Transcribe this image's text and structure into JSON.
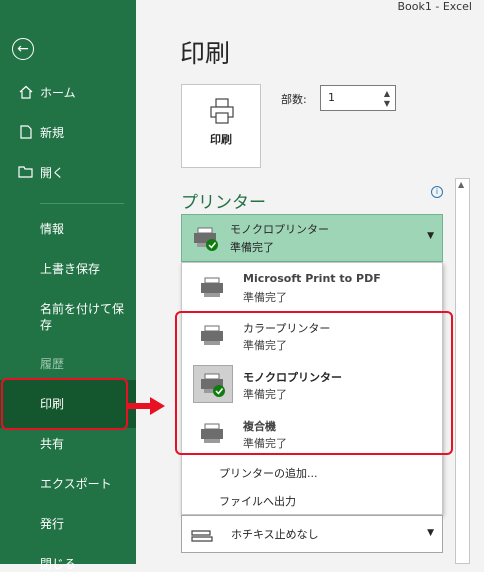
{
  "window": {
    "title": "Book1  -  Excel"
  },
  "sidebar": {
    "items": [
      {
        "label": "ホーム"
      },
      {
        "label": "新規"
      },
      {
        "label": "開く"
      },
      {
        "label": "情報"
      },
      {
        "label": "上書き保存"
      },
      {
        "label": "名前を付けて保存"
      },
      {
        "label": "履歴"
      },
      {
        "label": "印刷"
      },
      {
        "label": "共有"
      },
      {
        "label": "エクスポート"
      },
      {
        "label": "発行"
      },
      {
        "label": "閉じる"
      }
    ],
    "active_item": "印刷"
  },
  "main": {
    "title": "印刷",
    "print_button_label": "印刷",
    "copies_label": "部数:",
    "copies_value": "1",
    "printer_section_title": "プリンター",
    "selected_printer": {
      "name": "モノクロプリンター",
      "status": "準備完了"
    },
    "printers": [
      {
        "name": "Microsoft Print to PDF",
        "status": "準備完了"
      },
      {
        "name": "カラープリンター",
        "status": "準備完了"
      },
      {
        "name": "モノクロプリンター",
        "status": "準備完了"
      },
      {
        "name": "複合機",
        "status": "準備完了"
      }
    ],
    "menu_actions": [
      {
        "label": "プリンターの追加..."
      },
      {
        "label": "ファイルへ出力"
      }
    ],
    "staple_setting": "ホチキス止めなし"
  },
  "colors": {
    "sidebar_green": "#217346",
    "highlight_red": "#e81123",
    "accent_text_green": "#217346"
  }
}
